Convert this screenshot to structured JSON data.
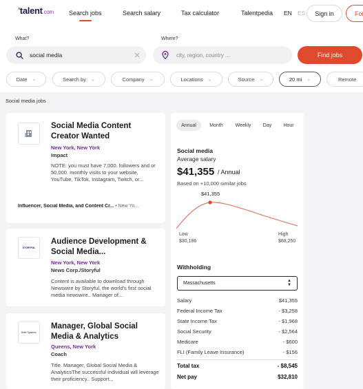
{
  "header": {
    "logo_main": "talent",
    "logo_suffix": ".com",
    "nav": [
      "Search jobs",
      "Search salary",
      "Tax calculator",
      "Talentpedia"
    ],
    "lang_active": "EN",
    "lang_other": "ES",
    "sign_in": "Sign in",
    "for_label": "For"
  },
  "search": {
    "what_label": "What?",
    "what_value": "social media",
    "where_label": "Where?",
    "where_placeholder": "city, region, country ...",
    "find_label": "Find jobs"
  },
  "filters": [
    "Date",
    "Search by",
    "Company",
    "Locations",
    "Source",
    "20 mi",
    "Remote"
  ],
  "breadcrumb": "Social media jobs",
  "jobs": [
    {
      "title": "Social Media Content Creator Wanted",
      "location": "New York, New York",
      "company": "Impact",
      "description": "NOTE: you must have 7,000. followers and or 50,000. monthly visits to your website, YouTube, TikTok, Instagram, Twitch, or...",
      "tags_strong": "Influencer, Social Media, and Content Cr...",
      "tags_extra": "• New Yo..."
    },
    {
      "title": "Audience Development & Social Media...",
      "location": "New York, New York",
      "company": "News Corp./Storyful",
      "description": "Content is available to download through Newswire by Storyful, the world's first social media newswire.. Manager of...",
      "logo_text": "STORYFUL"
    },
    {
      "title": "Manager, Global Social Media & Analytics",
      "location": "Queens, New York",
      "company": "Coach",
      "description": "Title. Manager, Global Social Media & AnalyticsThe successful individual will leverage their proficiency.. Support...",
      "logo_text": "Brief Systems"
    }
  ],
  "salary": {
    "tabs": [
      "Annual",
      "Month",
      "Weekly",
      "Day",
      "Hour"
    ],
    "active_tab": "Annual",
    "title": "Social media",
    "subtitle": "Average salary",
    "amount": "$41,355",
    "period": "/ Annual",
    "based_on": "Based on +10,000 similar jobs",
    "curve_label": "$41,355",
    "low_label": "Low",
    "low_value": "$30,186",
    "high_label": "High",
    "high_value": "$68,250",
    "withholding_label": "Withholding",
    "state": "Massachusetts",
    "rows": [
      {
        "label": "Salary",
        "value": "$41,355"
      },
      {
        "label": "Federal Income Tax",
        "value": "- $3,258"
      },
      {
        "label": "State Income Tax",
        "value": "- $1,968"
      },
      {
        "label": "Social Security",
        "value": "- $2,564"
      },
      {
        "label": "Medicare",
        "value": "- $600"
      },
      {
        "label": "FLI (Family Leave Insurance)",
        "value": "- $156"
      }
    ],
    "total_tax_label": "Total tax",
    "total_tax_value": "- $8,545",
    "net_pay_label": "Net pay",
    "net_pay_value": "$32,810"
  },
  "colors": {
    "accent": "#e04a2c",
    "location": "#6b2d8f",
    "brand_navy": "#1b1b4a"
  },
  "icons": [
    "search-icon",
    "clear-icon",
    "location-pin-icon",
    "chevron-down-icon",
    "building-logo-icon"
  ]
}
